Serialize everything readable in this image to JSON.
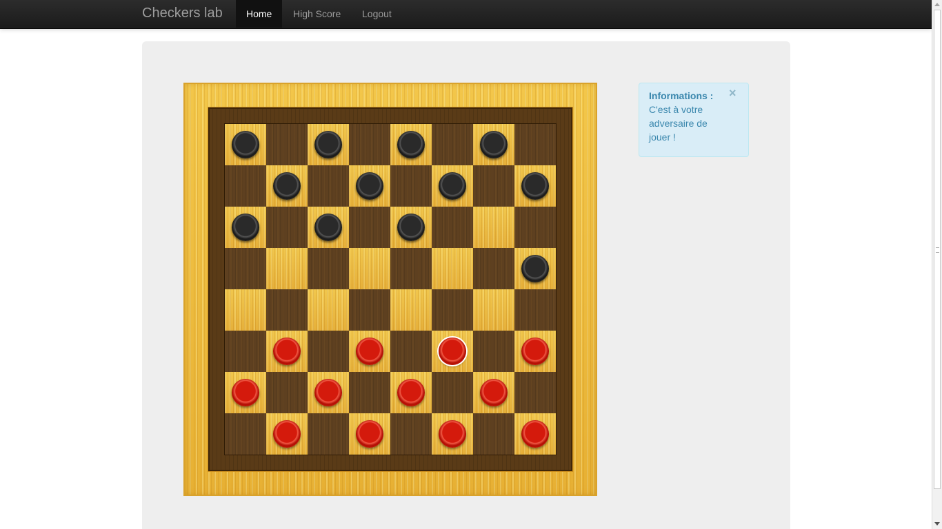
{
  "navbar": {
    "brand": "Checkers lab",
    "items": [
      {
        "label": "Home",
        "active": true
      },
      {
        "label": "High Score",
        "active": false
      },
      {
        "label": "Logout",
        "active": false
      }
    ]
  },
  "alert": {
    "title": "Informations :",
    "message": "C'est à votre adversaire de jouer !",
    "close": "×"
  },
  "board": {
    "size": 8,
    "rows": [
      "b.b.b.b.",
      ".b.b.b.b",
      "b.b.b...",
      ".......b",
      "........",
      ".r.r.R.r",
      "r.r.r.r.",
      ".r.r.r.r"
    ],
    "legend": {
      "b": "black piece",
      "r": "red piece",
      "R": "selected red piece",
      ".": "empty"
    }
  },
  "colors": {
    "navbar": "#1b1b1b",
    "hero": "#eeeeee",
    "light_square": "#ecbc44",
    "dark_square": "#5e4020",
    "black_piece": "#2a2a2a",
    "red_piece": "#d41a0c",
    "alert_bg": "#d9edf7",
    "alert_text": "#3a87ad"
  }
}
